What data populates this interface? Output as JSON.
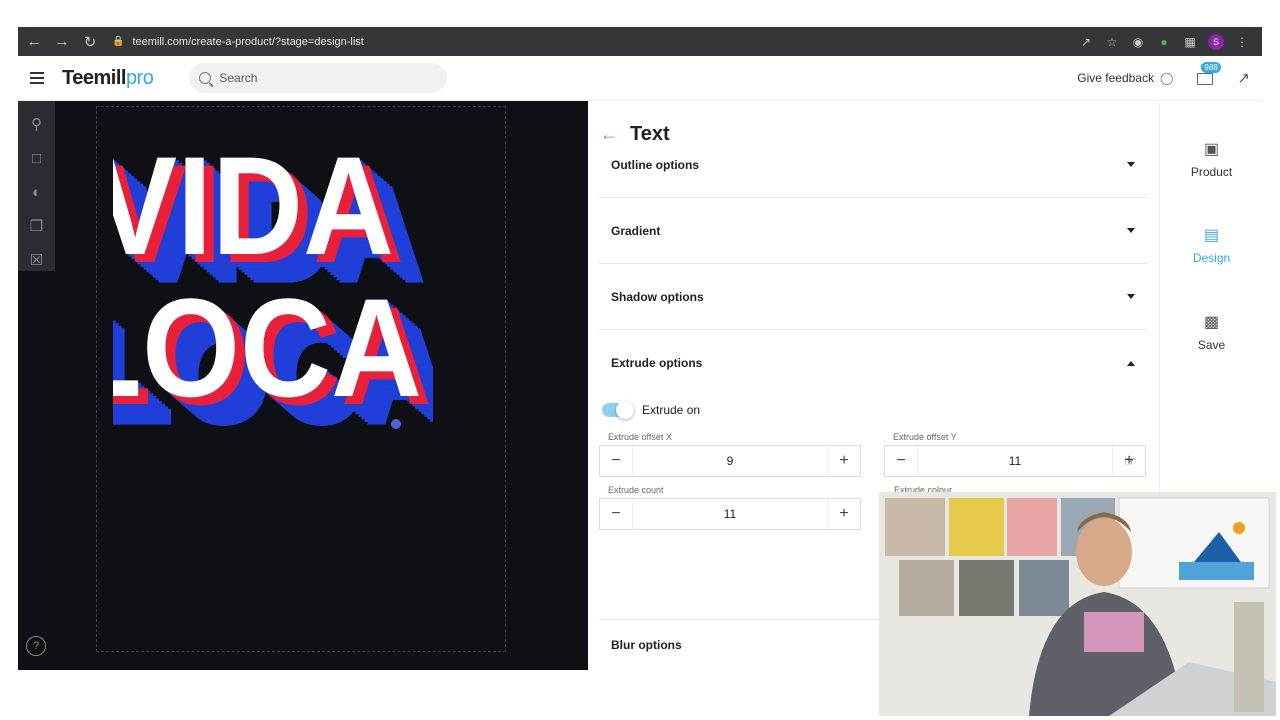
{
  "browser": {
    "url": "teemill.com/create-a-product/?stage=design-list",
    "profile_initial": "S"
  },
  "header": {
    "logo_main": "Teemill",
    "logo_suffix": "pro",
    "search_placeholder": "Search",
    "feedback_label": "Give feedback",
    "notification_count": "988"
  },
  "canvas": {
    "artwork_line1": "VIDA",
    "artwork_line2": "LOCA",
    "colors": {
      "fill": "#ffffff",
      "outline": "#e8203a",
      "extrude": "#1f3fd8",
      "background": "#0e1016"
    }
  },
  "panel": {
    "title": "Text",
    "sections": [
      {
        "label": "Outline options",
        "expanded": false
      },
      {
        "label": "Gradient",
        "expanded": false
      },
      {
        "label": "Shadow options",
        "expanded": false
      },
      {
        "label": "Extrude options",
        "expanded": true
      }
    ],
    "extrude": {
      "toggle_label": "Extrude on",
      "toggle_on": true,
      "offset_x_label": "Extrude offset X",
      "offset_x_value": "9",
      "offset_y_label": "Extrude offset Y",
      "offset_y_value": "11",
      "count_label": "Extrude count",
      "count_value": "11",
      "colour_label": "Extrude colour"
    },
    "blur_label": "Blur options"
  },
  "right_nav": {
    "items": [
      {
        "label": "Product",
        "icon": "tshirt-icon",
        "active": false
      },
      {
        "label": "Design",
        "icon": "image-icon",
        "active": true
      },
      {
        "label": "Save",
        "icon": "save-icon",
        "active": false
      }
    ]
  },
  "accent_color": "#36a9e1"
}
